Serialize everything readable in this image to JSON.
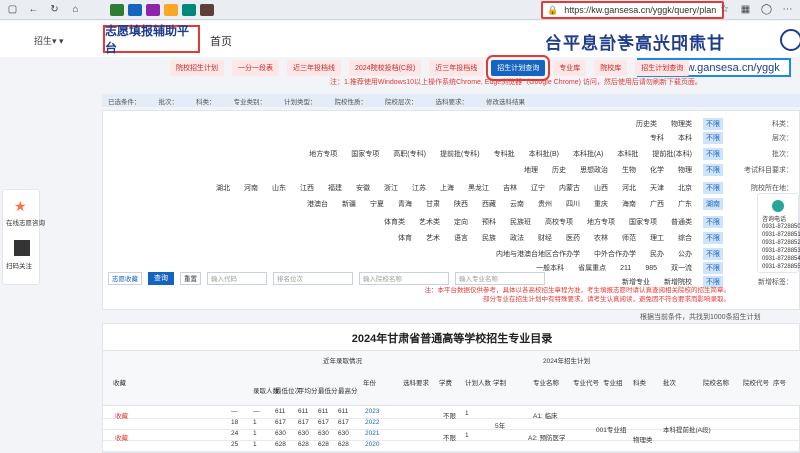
{
  "browser": {
    "url": "https://kw.gansesa.cn/yggk/query/plan",
    "tab_colors": [
      "#2e7d32",
      "#1565c0",
      "#8e24aa",
      "#f9a825",
      "#00897b",
      "#5d4037"
    ]
  },
  "header": {
    "site_title": "甘肃阳光高考信息平台",
    "nav_home": "首页",
    "nav_active": "志愿填报辅助平台",
    "user": "招生▾  ▾"
  },
  "domain_label": "https://kw.gansesa.cn/yggk",
  "actions": [
    "院校招生计划",
    "一分一段表",
    "近三年投档线",
    "2024院校投档(C段)",
    "近三年投档线",
    "招生计划查询",
    "专业库",
    "院校库",
    "招生计划查询"
  ],
  "notice": "注：1.推荐使用Windows10以上操作系统Chrome, Edge浏览器（Google Chrome) 访问，然后使用后请勿刷新下载页面。",
  "filterbar": [
    "已选条件：",
    "批次：",
    "科类：",
    "专业类别：",
    "计划类型：",
    "院校性质：",
    "院校层次：",
    "选科要求：",
    "修改选科结果"
  ],
  "filters": [
    {
      "label": "科类：",
      "items": [
        "不限",
        "物理类",
        "历史类"
      ]
    },
    {
      "label": "层次：",
      "items": [
        "不限",
        "本科",
        "专科"
      ]
    },
    {
      "label": "批次：",
      "items": [
        "不限",
        "提前批(本科)",
        "本科批",
        "本科批(A)",
        "本科批(B)",
        "专科批",
        "提前批(专科)",
        "高职(专科)",
        "国家专项",
        "地方专项"
      ]
    },
    {
      "label": "考试科目要求：",
      "items": [
        "不限",
        "物理",
        "化学",
        "生物",
        "思想政治",
        "历史",
        "地理"
      ]
    },
    {
      "label": "院校所在地：",
      "items": [
        "不限",
        "北京",
        "天津",
        "河北",
        "山西",
        "内蒙古",
        "辽宁",
        "吉林",
        "黑龙江",
        "上海",
        "江苏",
        "浙江",
        "安徽",
        "福建",
        "江西",
        "山东",
        "河南",
        "湖北"
      ]
    },
    {
      "label": "",
      "items": [
        "湖南",
        "广东",
        "广西",
        "海南",
        "重庆",
        "四川",
        "贵州",
        "云南",
        "西藏",
        "陕西",
        "甘肃",
        "青海",
        "宁夏",
        "新疆",
        "港澳台"
      ]
    },
    {
      "label": "计划类型：",
      "items": [
        "不限",
        "普通类",
        "国家专项",
        "地方专项",
        "高校专项",
        "民族班",
        "预科",
        "定向",
        "艺术类",
        "体育类"
      ]
    },
    {
      "label": "院校类型：",
      "items": [
        "不限",
        "综合",
        "理工",
        "师范",
        "农林",
        "医药",
        "财经",
        "政法",
        "民族",
        "语言",
        "艺术",
        "体育"
      ]
    },
    {
      "label": "院校性质：",
      "items": [
        "不限",
        "公办",
        "民办",
        "中外合作办学",
        "内地与港澳台地区合作办学"
      ]
    },
    {
      "label": "办学层次：",
      "items": [
        "不限",
        "双一流",
        "985",
        "211",
        "省属重点",
        "一般本科"
      ]
    },
    {
      "label": "新增标签：",
      "items": [
        "不限",
        "新增院校",
        "新增专业"
      ]
    }
  ],
  "search": {
    "major_placeholder": "输入专业名称",
    "school_placeholder": "输入院校名称",
    "code_placeholder": "输入代码",
    "score_label": "排名位次",
    "search_btn": "查询",
    "reset_btn": "重置",
    "collect_btn": "志愿收藏"
  },
  "warnings": [
    "注：本平台数据仅供参考，具体以各高校招生章程为准，考生填报志愿时请认真查阅相关院校的招生简章。",
    "部分专业在招生计划中有特殊要求，请考生认真阅读，避免因不符合要求而影响录取。"
  ],
  "left_panel": {
    "text1": "在线志愿咨询",
    "text2": "扫码关注"
  },
  "right_panel": {
    "title": "咨询电话",
    "phones": [
      "0931-8728850",
      "0931-8728851",
      "0931-8728852",
      "0931-8728853",
      "0931-8728854",
      "0931-8728855"
    ]
  },
  "table": {
    "note": "根据当前条件，共找到1000条招生计划",
    "title": "2024年甘肃省普通高等学校招生专业目录",
    "headers": [
      "序号",
      "院校代号",
      "院校名称",
      "批次",
      "科类",
      "专业组",
      "专业代号",
      "专业名称",
      "学制",
      "计划人数",
      "学费",
      "选科要求",
      "年份",
      "最高分",
      "最低分",
      "平均分",
      "最低位次",
      "录取人数",
      "收藏"
    ],
    "group_headers": {
      "plan": "2024年招生计划",
      "history": "近年录取情况"
    },
    "rows": [
      {
        "year": "2023",
        "cells": [
          "611",
          "611",
          "611",
          "611",
          "—",
          "—"
        ]
      },
      {
        "year": "2022",
        "cells": [
          "617",
          "617",
          "617",
          "617",
          "1",
          "18"
        ]
      },
      {
        "year": "2021",
        "cells": [
          "630",
          "630",
          "630",
          "630",
          "1",
          "24"
        ]
      },
      {
        "year": "2020",
        "cells": [
          "628",
          "628",
          "628",
          "628",
          "1",
          "25"
        ]
      }
    ],
    "school_cell": "本科提前批(A段)",
    "group_cell": "001专业组",
    "major_a": "A1: 临床",
    "major_b": "A2: 预防医学",
    "req_a": "不限",
    "req_b": "不限",
    "plan_a": "1",
    "plan_b": "1",
    "fee": "5年",
    "kind": "物理类",
    "collect": "收藏"
  }
}
